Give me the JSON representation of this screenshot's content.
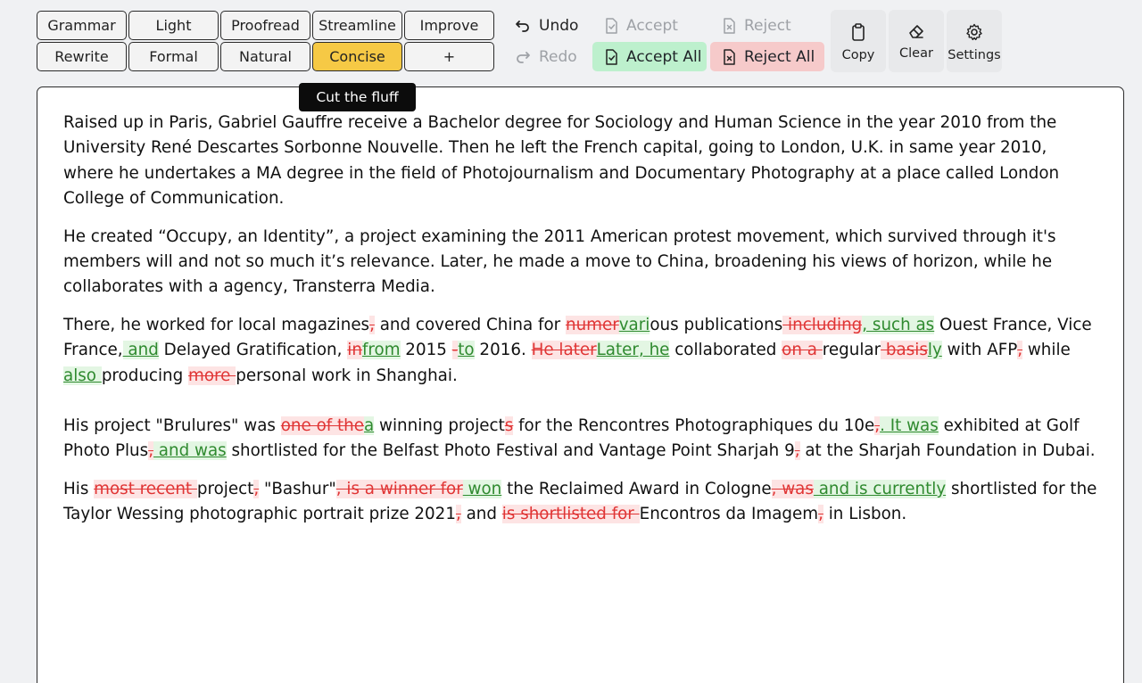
{
  "toolbar": {
    "modes_row1": [
      "Grammar",
      "Light",
      "Proofread",
      "Streamline",
      "Improve"
    ],
    "modes_row2": [
      "Rewrite",
      "Formal",
      "Natural",
      "Concise",
      "+"
    ],
    "active_mode": "Concise",
    "undo": "Undo",
    "redo": "Redo",
    "accept": "Accept",
    "accept_all": "Accept All",
    "reject": "Reject",
    "reject_all": "Reject All",
    "copy": "Copy",
    "clear": "Clear",
    "settings": "Settings"
  },
  "tooltip": "Cut the fluff",
  "colors": {
    "active": "#f6c945",
    "accept_all_bg": "#bdf0cd",
    "reject_all_bg": "#f6caca",
    "deleted": "#e03535",
    "inserted": "#2f8a2f"
  },
  "document": {
    "paragraphs": [
      [
        {
          "t": "plain",
          "s": "Raised up in Paris, Gabriel Gauffre receive a Bachelor degree for Sociology and Human Science in the year 2010 from the University René Descartes Sorbonne Nouvelle. Then he left the French capital, going to London, U.K. in same year 2010, where he undertakes a MA degree in the field of Photojournalism and Documentary Photography at a place called London College of Communication."
        }
      ],
      [
        {
          "t": "plain",
          "s": "He created “Occupy, an Identity”, a project examining the 2011 American protest movement, which survived through it's members will and not so much it’s relevance. Later, he made a move to China, broadening his views of horizon, while he collaborates with a agency, Transterra Media."
        }
      ],
      [
        {
          "t": "plain",
          "s": "There, he worked for local magazines"
        },
        {
          "t": "del",
          "s": ","
        },
        {
          "t": "plain",
          "s": " and covered China for "
        },
        {
          "t": "del",
          "s": "numer"
        },
        {
          "t": "ins",
          "s": "vari"
        },
        {
          "t": "plain",
          "s": "ous publications"
        },
        {
          "t": "del",
          "s": " including"
        },
        {
          "t": "ins",
          "s": ", such as"
        },
        {
          "t": "plain",
          "s": " Ouest France, Vice France,"
        },
        {
          "t": "ins",
          "s": " and"
        },
        {
          "t": "plain",
          "s": " Delayed Gratification, "
        },
        {
          "t": "del",
          "s": "in"
        },
        {
          "t": "ins",
          "s": "from"
        },
        {
          "t": "plain",
          "s": " 2015 "
        },
        {
          "t": "del",
          "s": "-"
        },
        {
          "t": "ins",
          "s": "to"
        },
        {
          "t": "plain",
          "s": " 2016. "
        },
        {
          "t": "del",
          "s": "He later"
        },
        {
          "t": "ins",
          "s": "Later, he"
        },
        {
          "t": "plain",
          "s": " collaborated "
        },
        {
          "t": "del",
          "s": "on a "
        },
        {
          "t": "plain",
          "s": "regular"
        },
        {
          "t": "del",
          "s": " basis"
        },
        {
          "t": "ins",
          "s": "ly"
        },
        {
          "t": "plain",
          "s": " with AFP"
        },
        {
          "t": "del",
          "s": ","
        },
        {
          "t": "plain",
          "s": " while "
        },
        {
          "t": "ins",
          "s": "also "
        },
        {
          "t": "plain",
          "s": "producing "
        },
        {
          "t": "del",
          "s": "more "
        },
        {
          "t": "plain",
          "s": "personal work in Shanghai."
        }
      ],
      [
        {
          "t": "plain",
          "s": "His project \"Brulures\" was "
        },
        {
          "t": "del",
          "s": "one of the"
        },
        {
          "t": "ins",
          "s": "a"
        },
        {
          "t": "plain",
          "s": " winning project"
        },
        {
          "t": "del",
          "s": "s"
        },
        {
          "t": "plain",
          "s": " for the Rencontres Photographiques du 10e"
        },
        {
          "t": "del",
          "s": ","
        },
        {
          "t": "ins",
          "s": ". It was"
        },
        {
          "t": "plain",
          "s": " exhibited at Golf Photo Plus"
        },
        {
          "t": "del",
          "s": ","
        },
        {
          "t": "ins",
          "s": " and was"
        },
        {
          "t": "plain",
          "s": " shortlisted for the Belfast Photo Festival and Vantage Point Sharjah 9"
        },
        {
          "t": "del",
          "s": ","
        },
        {
          "t": "plain",
          "s": " at the Sharjah Foundation in Dubai."
        }
      ],
      [
        {
          "t": "plain",
          "s": "His "
        },
        {
          "t": "del",
          "s": "most recent "
        },
        {
          "t": "plain",
          "s": "project"
        },
        {
          "t": "del",
          "s": ","
        },
        {
          "t": "plain",
          "s": " \"Bashur\""
        },
        {
          "t": "del",
          "s": ", is a winner for"
        },
        {
          "t": "ins",
          "s": " won"
        },
        {
          "t": "plain",
          "s": " the Reclaimed Award in Cologne"
        },
        {
          "t": "del",
          "s": ", was"
        },
        {
          "t": "ins",
          "s": " and is currently"
        },
        {
          "t": "plain",
          "s": " shortlisted for the Taylor Wessing photographic portrait prize 2021"
        },
        {
          "t": "del",
          "s": ","
        },
        {
          "t": "plain",
          "s": " and "
        },
        {
          "t": "del",
          "s": "is shortlisted for "
        },
        {
          "t": "plain",
          "s": "Encontros da Imagem"
        },
        {
          "t": "del",
          "s": ","
        },
        {
          "t": "plain",
          "s": " in Lisbon."
        }
      ]
    ]
  }
}
